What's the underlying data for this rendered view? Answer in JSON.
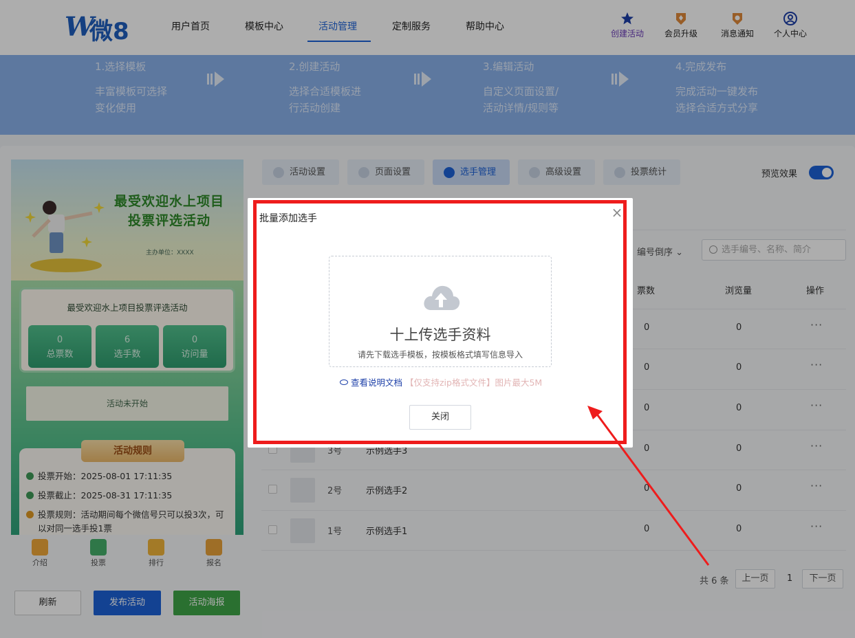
{
  "header": {
    "logo_text": "微8",
    "nav": [
      "用户首页",
      "模板中心",
      "活动管理",
      "定制服务",
      "帮助中心"
    ],
    "active_nav": "活动管理",
    "tools": {
      "create": "创建活动",
      "upgrade": "会员升级",
      "notify": "消息通知",
      "profile": "个人中心"
    },
    "accent_color": "#1c62d8"
  },
  "banner": {
    "steps": [
      {
        "title": "1.选择模板",
        "line1": "丰富模板可选择",
        "line2": "变化使用"
      },
      {
        "title": "2.创建活动",
        "line1": "选择合适模板进",
        "line2": "行活动创建"
      },
      {
        "title": "3.编辑活动",
        "line1": "自定义页面设置/",
        "line2": "活动详情/规则等"
      },
      {
        "title": "4.完成发布",
        "line1": "完成活动一键发布",
        "line2": "选择合适方式分享"
      }
    ]
  },
  "preview": {
    "title_line1": "最受欢迎水上项目",
    "title_line2": "投票评选活动",
    "sponsor": "主办单位：XXXX",
    "card_title": "最受欢迎水上项目投票评选活动",
    "stats": [
      {
        "value": "0",
        "label": "总票数"
      },
      {
        "value": "6",
        "label": "选手数"
      },
      {
        "value": "0",
        "label": "访问量"
      }
    ],
    "status": "活动未开始",
    "rules_title": "活动规则",
    "rules": [
      "投票开始：2025-08-01 17:11:35",
      "投票截止：2025-08-31 17:11:35",
      "投票规则：活动期间每个微信号只可以投3次，可"
    ],
    "rules_cut": "以对同一选手投1票",
    "tabs": [
      "介绍",
      "投票",
      "排行",
      "报名"
    ]
  },
  "actions": {
    "refresh": "刷新",
    "publish": "发布活动",
    "poster": "活动海报"
  },
  "tabs": [
    "活动设置",
    "页面设置",
    "选手管理",
    "高级设置",
    "投票统计"
  ],
  "active_tab": "选手管理",
  "preview_toggle": {
    "label": "预览效果",
    "on": true
  },
  "list": {
    "sort": "编号倒序",
    "search_placeholder": "选手编号、名称、简介",
    "columns": {
      "votes": "票数",
      "views": "浏览量",
      "ops": "操作"
    },
    "rows": [
      {
        "num": "",
        "name": "",
        "votes": "0",
        "views": "0"
      },
      {
        "num": "",
        "name": "",
        "votes": "0",
        "views": "0"
      },
      {
        "num": "",
        "name": "",
        "votes": "0",
        "views": "0"
      },
      {
        "num": "3号",
        "name": "示例选手3",
        "votes": "0",
        "views": "0"
      },
      {
        "num": "2号",
        "name": "示例选手2",
        "votes": "0",
        "views": "0"
      },
      {
        "num": "1号",
        "name": "示例选手1",
        "votes": "0",
        "views": "0"
      }
    ],
    "ops_symbol": "···"
  },
  "pager": {
    "total": "共 6 条",
    "prev": "上一页",
    "current": "1",
    "next": "下一页"
  },
  "modal": {
    "title": "批量添加选手",
    "close_symbol": "×",
    "upload_title": "十上传选手资料",
    "upload_hint": "请先下载选手模板，按模板格式填写信息导入",
    "doc_link": "查看说明文档",
    "doc_note": "【仅支持zip格式文件】图片最大5M",
    "close_button": "关闭"
  },
  "annotation_color": "#ee1c1c"
}
